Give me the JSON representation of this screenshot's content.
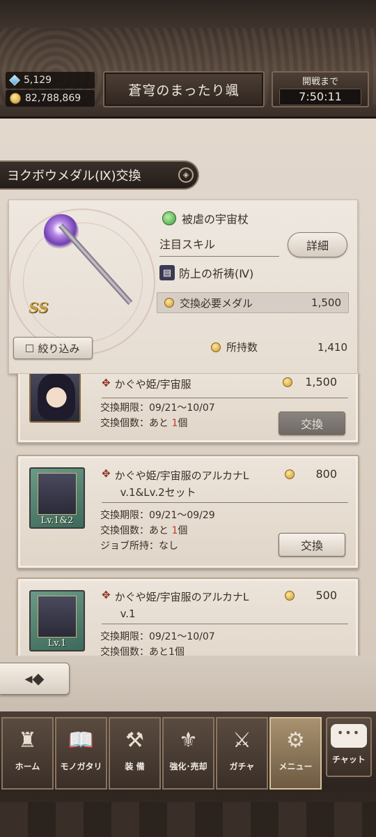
{
  "header": {
    "gems": "5,129",
    "gold": "82,788,869",
    "guild_name": "蒼穹のまったり颯",
    "battle_label": "開戦まで",
    "battle_time": "7:50:11"
  },
  "exchange": {
    "tab_title": "ヨクボウメダル(Ⅸ)交換",
    "emblem": "◈",
    "featured": {
      "weapon_name": "被虐の宇宙杖",
      "rarity": "SS",
      "skill_label": "注目スキル",
      "detail_button": "詳細",
      "skill_name": "防上の祈祷(Ⅳ)",
      "required_label": "交換必要メダル",
      "required_value": "1,500"
    },
    "filter_button": "絞り込み",
    "owned_label": "所持数",
    "owned_value": "1,410"
  },
  "items": [
    {
      "title": "かぐや姫/宇宙服",
      "price": "1,500",
      "period": "交換期限：09/21～10/07",
      "count_prefix": "交換個数：あと",
      "count_value": "1",
      "count_suffix": "個",
      "button": "交換"
    },
    {
      "title_line1": "かぐや姫/宇宙服のアルカナL",
      "title_line2": "v.1&Lv.2セット",
      "price": "800",
      "level_badge": "Lv.1&2",
      "period": "交換期限：09/21～09/29",
      "count_prefix": "交換個数：あと",
      "count_value": "1",
      "count_suffix": "個",
      "job": "ジョブ所持：なし",
      "button": "交換"
    },
    {
      "title_line1": "かぐや姫/宇宙服のアルカナL",
      "title_line2": "v.1",
      "price": "500",
      "level_badge": "Lv.1",
      "period": "交換期限：09/21～10/07",
      "count_partial": "交換個数：あと1個"
    }
  ],
  "back_icon": "back-arrow-icon",
  "menu": {
    "home": "ホーム",
    "story": "モノガタリ",
    "equip": "装 備",
    "enhance": "強化･売却",
    "gacha": "ガチャ",
    "menu": "メニュー",
    "chat": "チャット",
    "chat_bubble": "•••"
  }
}
